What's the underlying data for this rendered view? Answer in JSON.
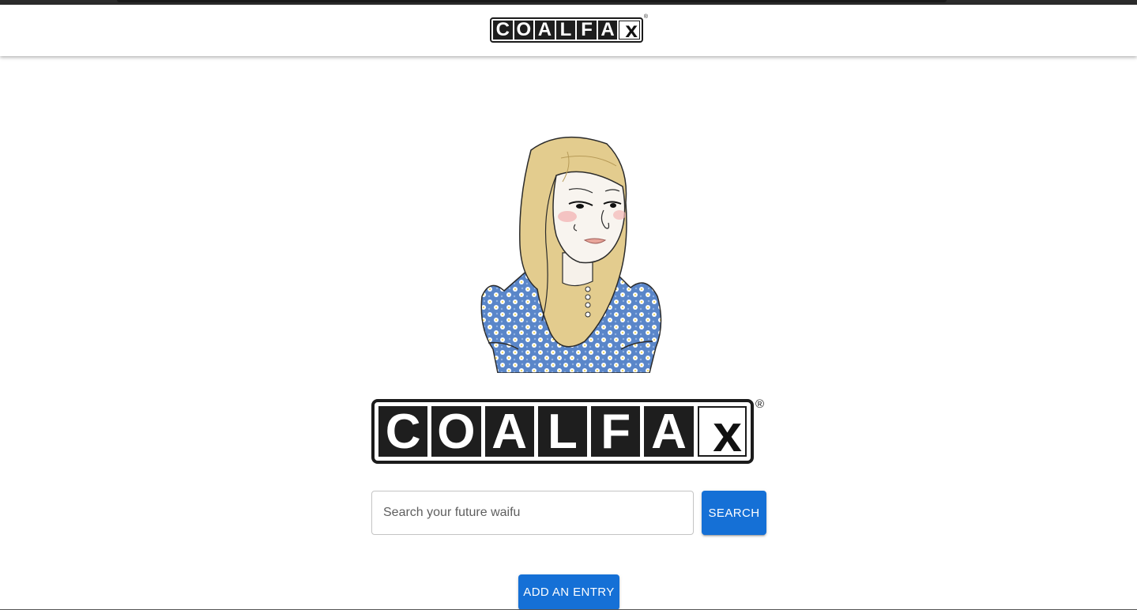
{
  "header": {
    "logo": {
      "letters": [
        "C",
        "O",
        "A",
        "L",
        "F",
        "A"
      ],
      "tail": "x",
      "registered": "®"
    }
  },
  "hero": {
    "illustration_alt": "cartoon-girl-illustration",
    "logo": {
      "letters": [
        "C",
        "O",
        "A",
        "L",
        "F",
        "A"
      ],
      "tail": "x",
      "registered": "®"
    }
  },
  "search": {
    "placeholder": "Search your future waifu",
    "value": "",
    "button_label": "SEARCH"
  },
  "actions": {
    "add_entry_label": "ADD AN ENTRY"
  },
  "colors": {
    "primary": "#1570d6",
    "logo_dark": "#1e1e1e"
  }
}
